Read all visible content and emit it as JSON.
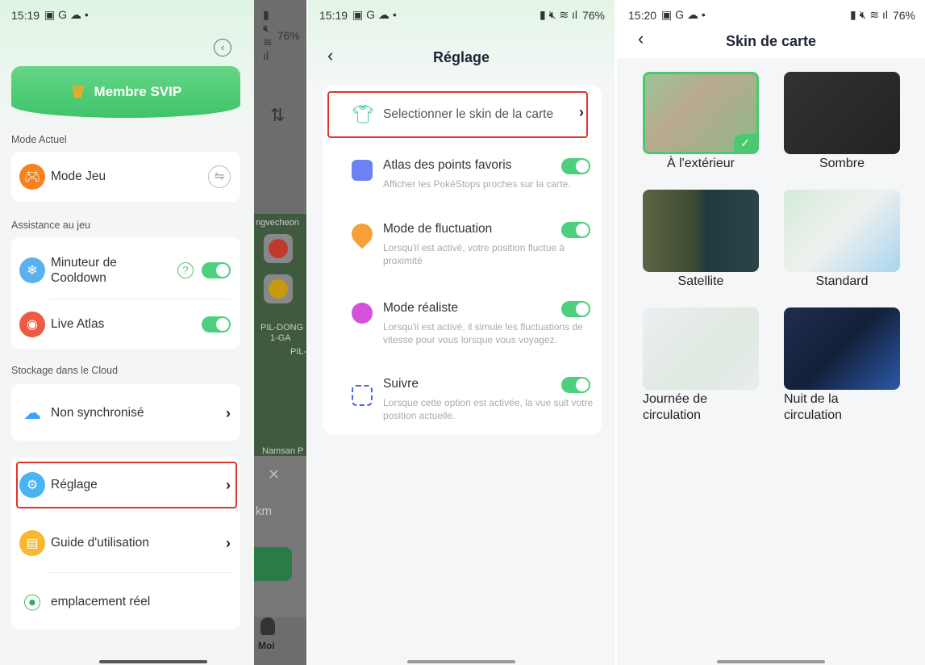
{
  "status_bars": [
    {
      "time": "15:19",
      "battery": "76%"
    },
    {
      "time": "15:19",
      "battery": "76%"
    },
    {
      "time": "15:20",
      "battery": "76%"
    }
  ],
  "menu": {
    "svip_label": "Membre SVIP",
    "sections": {
      "current": "Mode Actuel",
      "assist": "Assistance au jeu",
      "cloud": "Stockage dans le Cloud"
    },
    "mode": "Mode Jeu",
    "cooldown": "Minuteur de Cooldown",
    "cooldown_on": true,
    "live_atlas": "Live Atlas",
    "live_atlas_on": true,
    "sync": "Non synchronisé",
    "settings": "Réglage",
    "guide": "Guide d'utilisation",
    "real_location": "emplacement réel"
  },
  "map_bg": {
    "labels": [
      "ngvecheon",
      "PIL-DONG",
      "1-GA",
      "PIL-",
      "Namsan P"
    ],
    "distance_unit": "km",
    "tab": "Moi"
  },
  "settings": {
    "title": "Réglage",
    "skin": "Selectionner le skin de la carte",
    "items": [
      {
        "title": "Atlas des points favoris",
        "desc": "Afficher les PokéStops proches sur la carte.",
        "on": true
      },
      {
        "title": "Mode de fluctuation",
        "desc": "Lorsqu'il est activé, votre position fluctue à proximité",
        "on": true
      },
      {
        "title": "Mode réaliste",
        "desc": "Lorsqu'il est activé, il simule les fluctuations de vitesse pour vous lorsque vous voyagez.",
        "on": true
      },
      {
        "title": "Suivre",
        "desc": "Lorsque cette option est activée, la vue suit votre position actuelle.",
        "on": true
      }
    ]
  },
  "skins": {
    "title": "Skin de carte",
    "items": [
      {
        "label": "À l'extérieur",
        "selected": true,
        "color": "#8fb88a"
      },
      {
        "label": "Sombre",
        "color": "#2b2b2b"
      },
      {
        "label": "Satellite",
        "color": "#4f5a3e"
      },
      {
        "label": "Standard",
        "color": "#cfe6d8"
      },
      {
        "label": "Journée de circulation",
        "color": "#e8ecef"
      },
      {
        "label": "Nuit de la circulation",
        "color": "#1d2a44"
      }
    ]
  },
  "colors": {
    "accent": "#4cd07d",
    "highlight": "#e0352b"
  }
}
